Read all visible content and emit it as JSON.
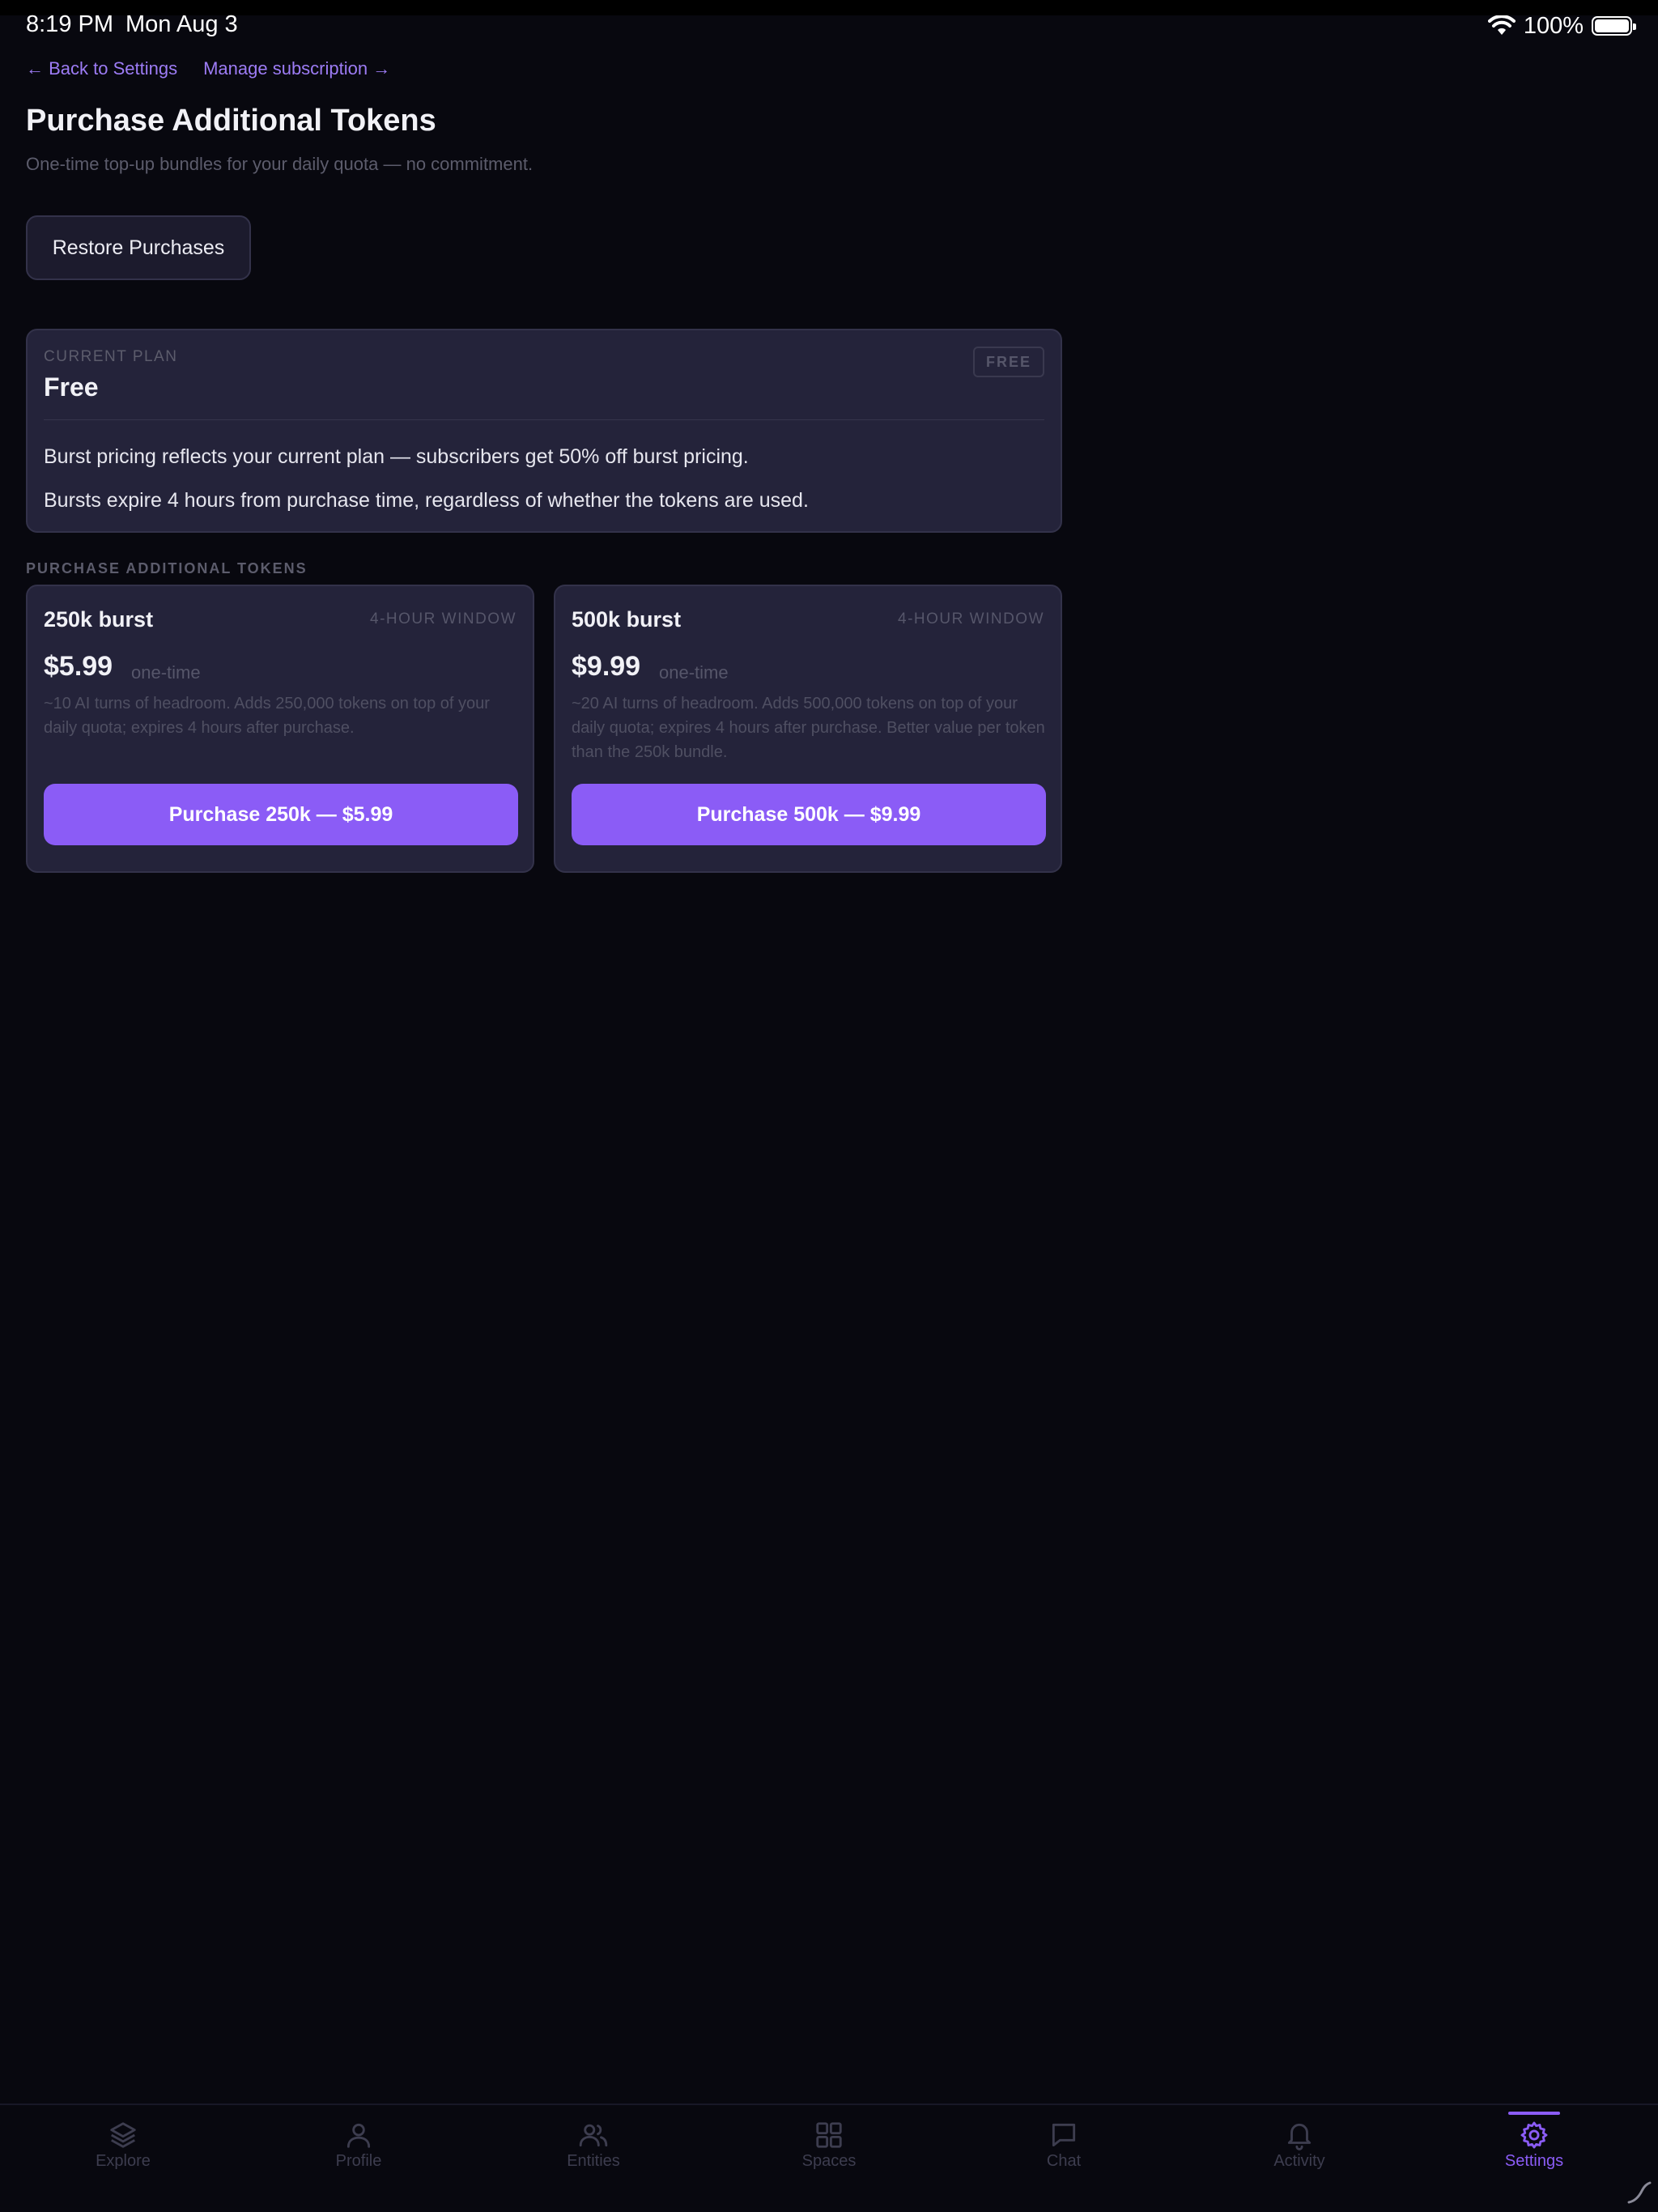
{
  "status": {
    "time": "8:19 PM",
    "date": "Mon Aug 3",
    "battery": "100%"
  },
  "nav": {
    "back": "← Back to Settings",
    "manage": "Manage subscription →"
  },
  "header": {
    "title": "Purchase Additional Tokens",
    "subtitle": "One-time top-up bundles for your daily quota — no commitment."
  },
  "restore_label": "Restore Purchases",
  "plan": {
    "label": "CURRENT PLAN",
    "name": "Free",
    "badge": "FREE",
    "note1": "Burst pricing reflects your current plan — subscribers get 50% off burst pricing.",
    "note2": "Bursts expire 4 hours from purchase time, regardless of whether the tokens are used."
  },
  "section_label": "PURCHASE ADDITIONAL TOKENS",
  "bundles": [
    {
      "name": "250k burst",
      "window": "4-HOUR WINDOW",
      "price": "$5.99",
      "frequency": "one-time",
      "description": "~10 AI turns of headroom. Adds 250,000 tokens on top of your daily quota; expires 4 hours after purchase.",
      "button": "Purchase 250k — $5.99"
    },
    {
      "name": "500k burst",
      "window": "4-HOUR WINDOW",
      "price": "$9.99",
      "frequency": "one-time",
      "description": "~20 AI turns of headroom. Adds 500,000 tokens on top of your daily quota; expires 4 hours after purchase. Better value per token than the 250k bundle.",
      "button": "Purchase 500k — $9.99"
    }
  ],
  "tabs": [
    {
      "label": "Explore",
      "icon": "layers-icon"
    },
    {
      "label": "Profile",
      "icon": "person-icon"
    },
    {
      "label": "Entities",
      "icon": "people-icon"
    },
    {
      "label": "Spaces",
      "icon": "grid-icon"
    },
    {
      "label": "Chat",
      "icon": "chat-bubble-icon"
    },
    {
      "label": "Activity",
      "icon": "bell-icon"
    },
    {
      "label": "Settings",
      "icon": "gear-icon",
      "active": true
    }
  ],
  "colors": {
    "accent": "#8b5cf6",
    "background": "#08080f",
    "card": "#24233a"
  }
}
